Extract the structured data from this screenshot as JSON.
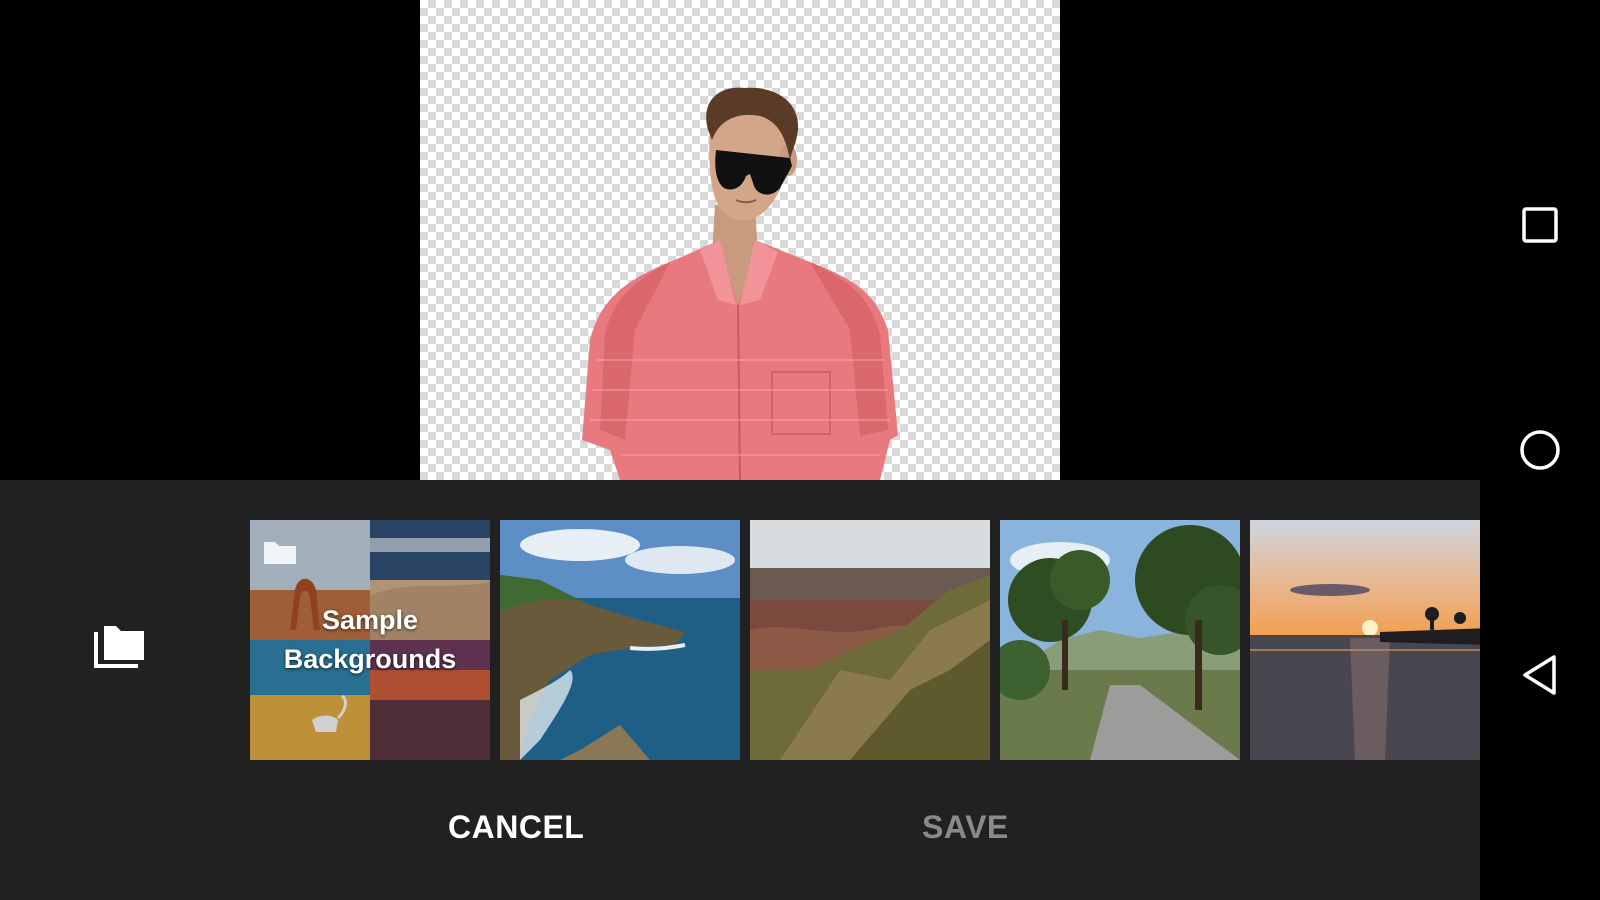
{
  "colors": {
    "panel_background": "#212121",
    "primary_text": "#ffffff",
    "disabled_text": "#8a8a8a",
    "shirt": "#e87a7f"
  },
  "preview": {
    "background": "transparent-checkerboard",
    "subject": "man-in-pink-shirt-and-sunglasses"
  },
  "panel": {
    "folder_icon": "folder-stack-icon",
    "thumbnails": [
      {
        "type": "sample",
        "label_line1": "Sample",
        "label_line2": "Backgrounds",
        "icon": "folder-icon"
      },
      {
        "type": "photo",
        "scene": "rocky-coast-ocean"
      },
      {
        "type": "photo",
        "scene": "canyon-cliffs"
      },
      {
        "type": "photo",
        "scene": "tree-lined-road"
      },
      {
        "type": "photo",
        "scene": "ocean-sunset"
      }
    ]
  },
  "actions": {
    "cancel_label": "CANCEL",
    "save_label": "SAVE"
  },
  "navigation": {
    "recents_icon": "square-recents-icon",
    "home_icon": "circle-home-icon",
    "back_icon": "triangle-back-icon"
  }
}
